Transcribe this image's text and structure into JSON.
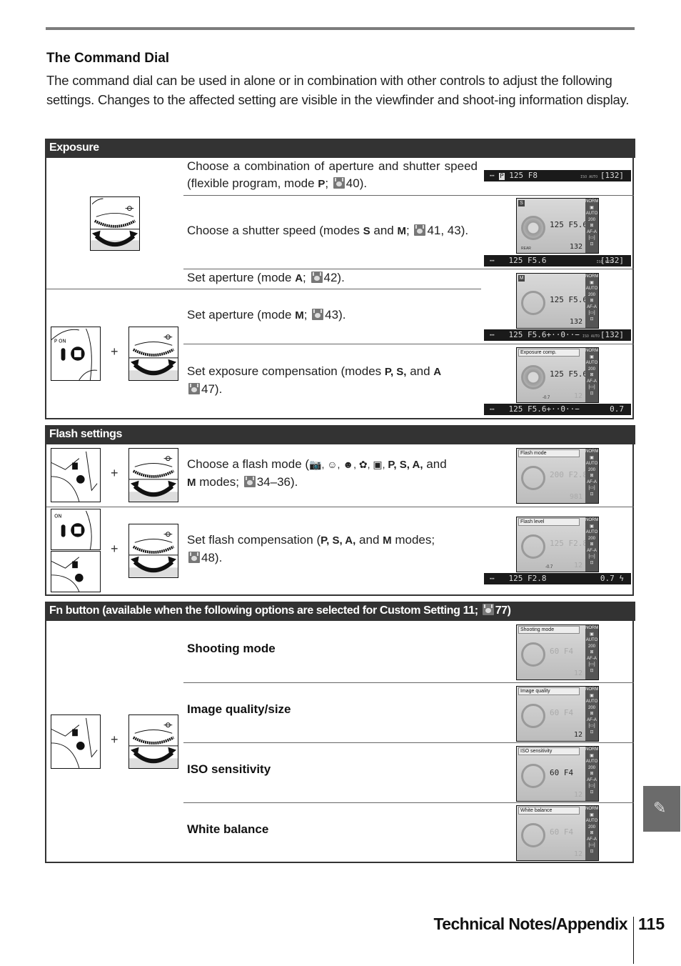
{
  "header": {
    "title": "The Command Dial",
    "intro": "The command dial can be used in alone or in combination with other controls to adjust the following settings.  Changes to the affected setting are visible in the viewfinder and shoot-ing information display."
  },
  "exposure": {
    "heading": "Exposure",
    "rows": [
      {
        "pre": "Choose a combination of aperture and shutter speed (flexible program, mode ",
        "mode": "P",
        "post": "; ",
        "ref": "40).",
        "vf": {
          "mode": "P",
          "shutter": "125",
          "aperture": "F8",
          "iso": "ISO AUTO",
          "count": "[132]"
        }
      },
      {
        "pre": "Choose a shutter speed (modes ",
        "mode": "S",
        "mid": " and ",
        "mode2": "M",
        "post": "; ",
        "ref": "41, 43).",
        "lcd": {
          "mode": "S",
          "shutter": "125",
          "aperture": "F5.6",
          "count": "132",
          "bottom_left": "REAR"
        },
        "vf": {
          "shutter": "125",
          "aperture": "F5.6",
          "iso": "ISO AUTO",
          "count": "[132]"
        }
      },
      {
        "pre": "Set aperture (mode ",
        "mode": "A",
        "post": "; ",
        "ref": "42)."
      },
      {
        "pre": "Set aperture (mode ",
        "mode": "M",
        "post": "; ",
        "ref": "43).",
        "lcd": {
          "mode": "M",
          "shutter": "125",
          "aperture": "F5.6",
          "count": "132"
        },
        "vf": {
          "shutter": "125",
          "aperture": "F5.6+··0··−",
          "iso": "ISO AUTO",
          "count": "[132]"
        }
      },
      {
        "pre": "Set exposure compensation (modes ",
        "modes": "P, S,",
        "mid": " and ",
        "mode2": "A",
        "ref": "47).",
        "lcd": {
          "label": "Exposure comp.",
          "shutter": "125",
          "aperture": "F5.6",
          "comp": "-0.7",
          "count": "12"
        },
        "vf": {
          "shutter": "125",
          "aperture": "F5.6+··0··−",
          "value": "0.7"
        }
      }
    ]
  },
  "flash": {
    "heading": "Flash settings",
    "rows": [
      {
        "pre": "Choose a flash mode (",
        "icons": "AUTO, portrait, child, close-up, night portrait",
        "modes": "P, S, A,",
        "mid": " and ",
        "mode2": "M",
        "post": " modes; ",
        "ref": "34–36).",
        "lcd": {
          "label": "Flash mode",
          "shutter": "200",
          "aperture": "F2.8",
          "count": "981"
        }
      },
      {
        "pre": "Set flash compensation (",
        "modes": "P, S, A,",
        "mid": " and ",
        "mode2": "M",
        "post": " modes; ",
        "ref": "48).",
        "lcd": {
          "label": "Flash level",
          "shutter": "125",
          "aperture": "F2.8",
          "comp": "-0.7",
          "count": "12"
        },
        "vf": {
          "shutter": "125",
          "aperture": "F2.8",
          "value": "0.7 ϟ"
        }
      }
    ]
  },
  "fn": {
    "heading_pre": "Fn button (available when the following options are selected for Custom Setting 11; ",
    "heading_ref": "77)",
    "rows": [
      {
        "label": "Shooting mode",
        "lcd": {
          "label": "Shooting mode",
          "shutter": "60",
          "aperture": "F4",
          "count": "12"
        }
      },
      {
        "label": "Image quality/size",
        "lcd": {
          "label": "Image quality",
          "shutter": "60",
          "aperture": "F4",
          "count": "12"
        }
      },
      {
        "label": "ISO sensitivity",
        "lcd": {
          "label": "ISO sensitivity",
          "shutter": "60",
          "aperture": "F4",
          "count": "12"
        }
      },
      {
        "label": "White balance",
        "lcd": {
          "label": "White balance",
          "shutter": "60",
          "aperture": "F4",
          "count": "12"
        }
      }
    ]
  },
  "lcd_side": [
    "NORM",
    "▣",
    "AUTO",
    "200",
    "⊠",
    "AF-A",
    "[▭]",
    "⊡"
  ],
  "footer": {
    "section": "Technical Notes/Appendix",
    "page": "115"
  },
  "side_tab": {
    "icon": "pen-icon",
    "glyph": "✎"
  }
}
